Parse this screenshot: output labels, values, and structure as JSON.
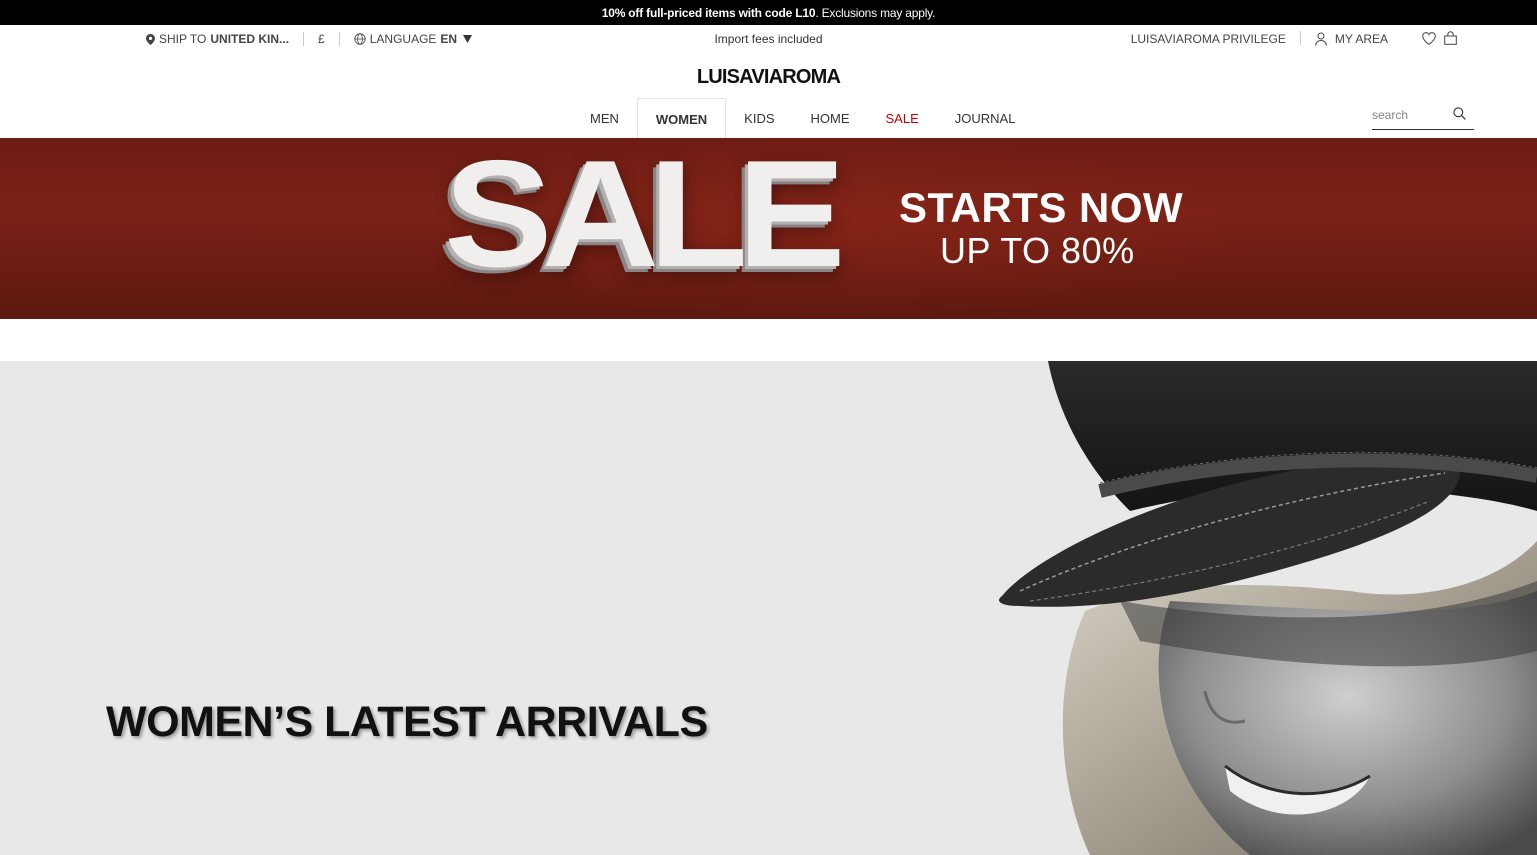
{
  "promo": {
    "text_before": "10% off full-priced items with code ",
    "code": "L10",
    "text_after": ". Exclusions may apply."
  },
  "utility": {
    "ship_to_label": "SHIP TO",
    "ship_to_value": "UNITED KIN...",
    "currency": "£",
    "language_label": "LANGUAGE",
    "language_value": "EN",
    "import_fees": "Import fees included",
    "privilege": "LUISAVIAROMA PRIVILEGE",
    "my_area": "MY AREA",
    "icons": [
      "location-pin-icon",
      "globe-icon",
      "caret-down-icon",
      "user-icon",
      "heart-icon",
      "bag-icon"
    ]
  },
  "brand": {
    "logo": "LUISAVIAROMA"
  },
  "nav": {
    "items": [
      {
        "label": "MEN"
      },
      {
        "label": "WOMEN",
        "active": true
      },
      {
        "label": "KIDS"
      },
      {
        "label": "HOME"
      },
      {
        "label": "SALE",
        "color": "#cc0000"
      },
      {
        "label": "JOURNAL"
      }
    ],
    "search_placeholder": "search"
  },
  "sale_banner": {
    "headline": "SALE",
    "line1": "STARTS NOW",
    "line2": "UP TO 80%",
    "background": "#6e1c14"
  },
  "hero": {
    "title": "WOMEN’S LATEST ARRIVALS",
    "background": "#e8e8e8"
  }
}
